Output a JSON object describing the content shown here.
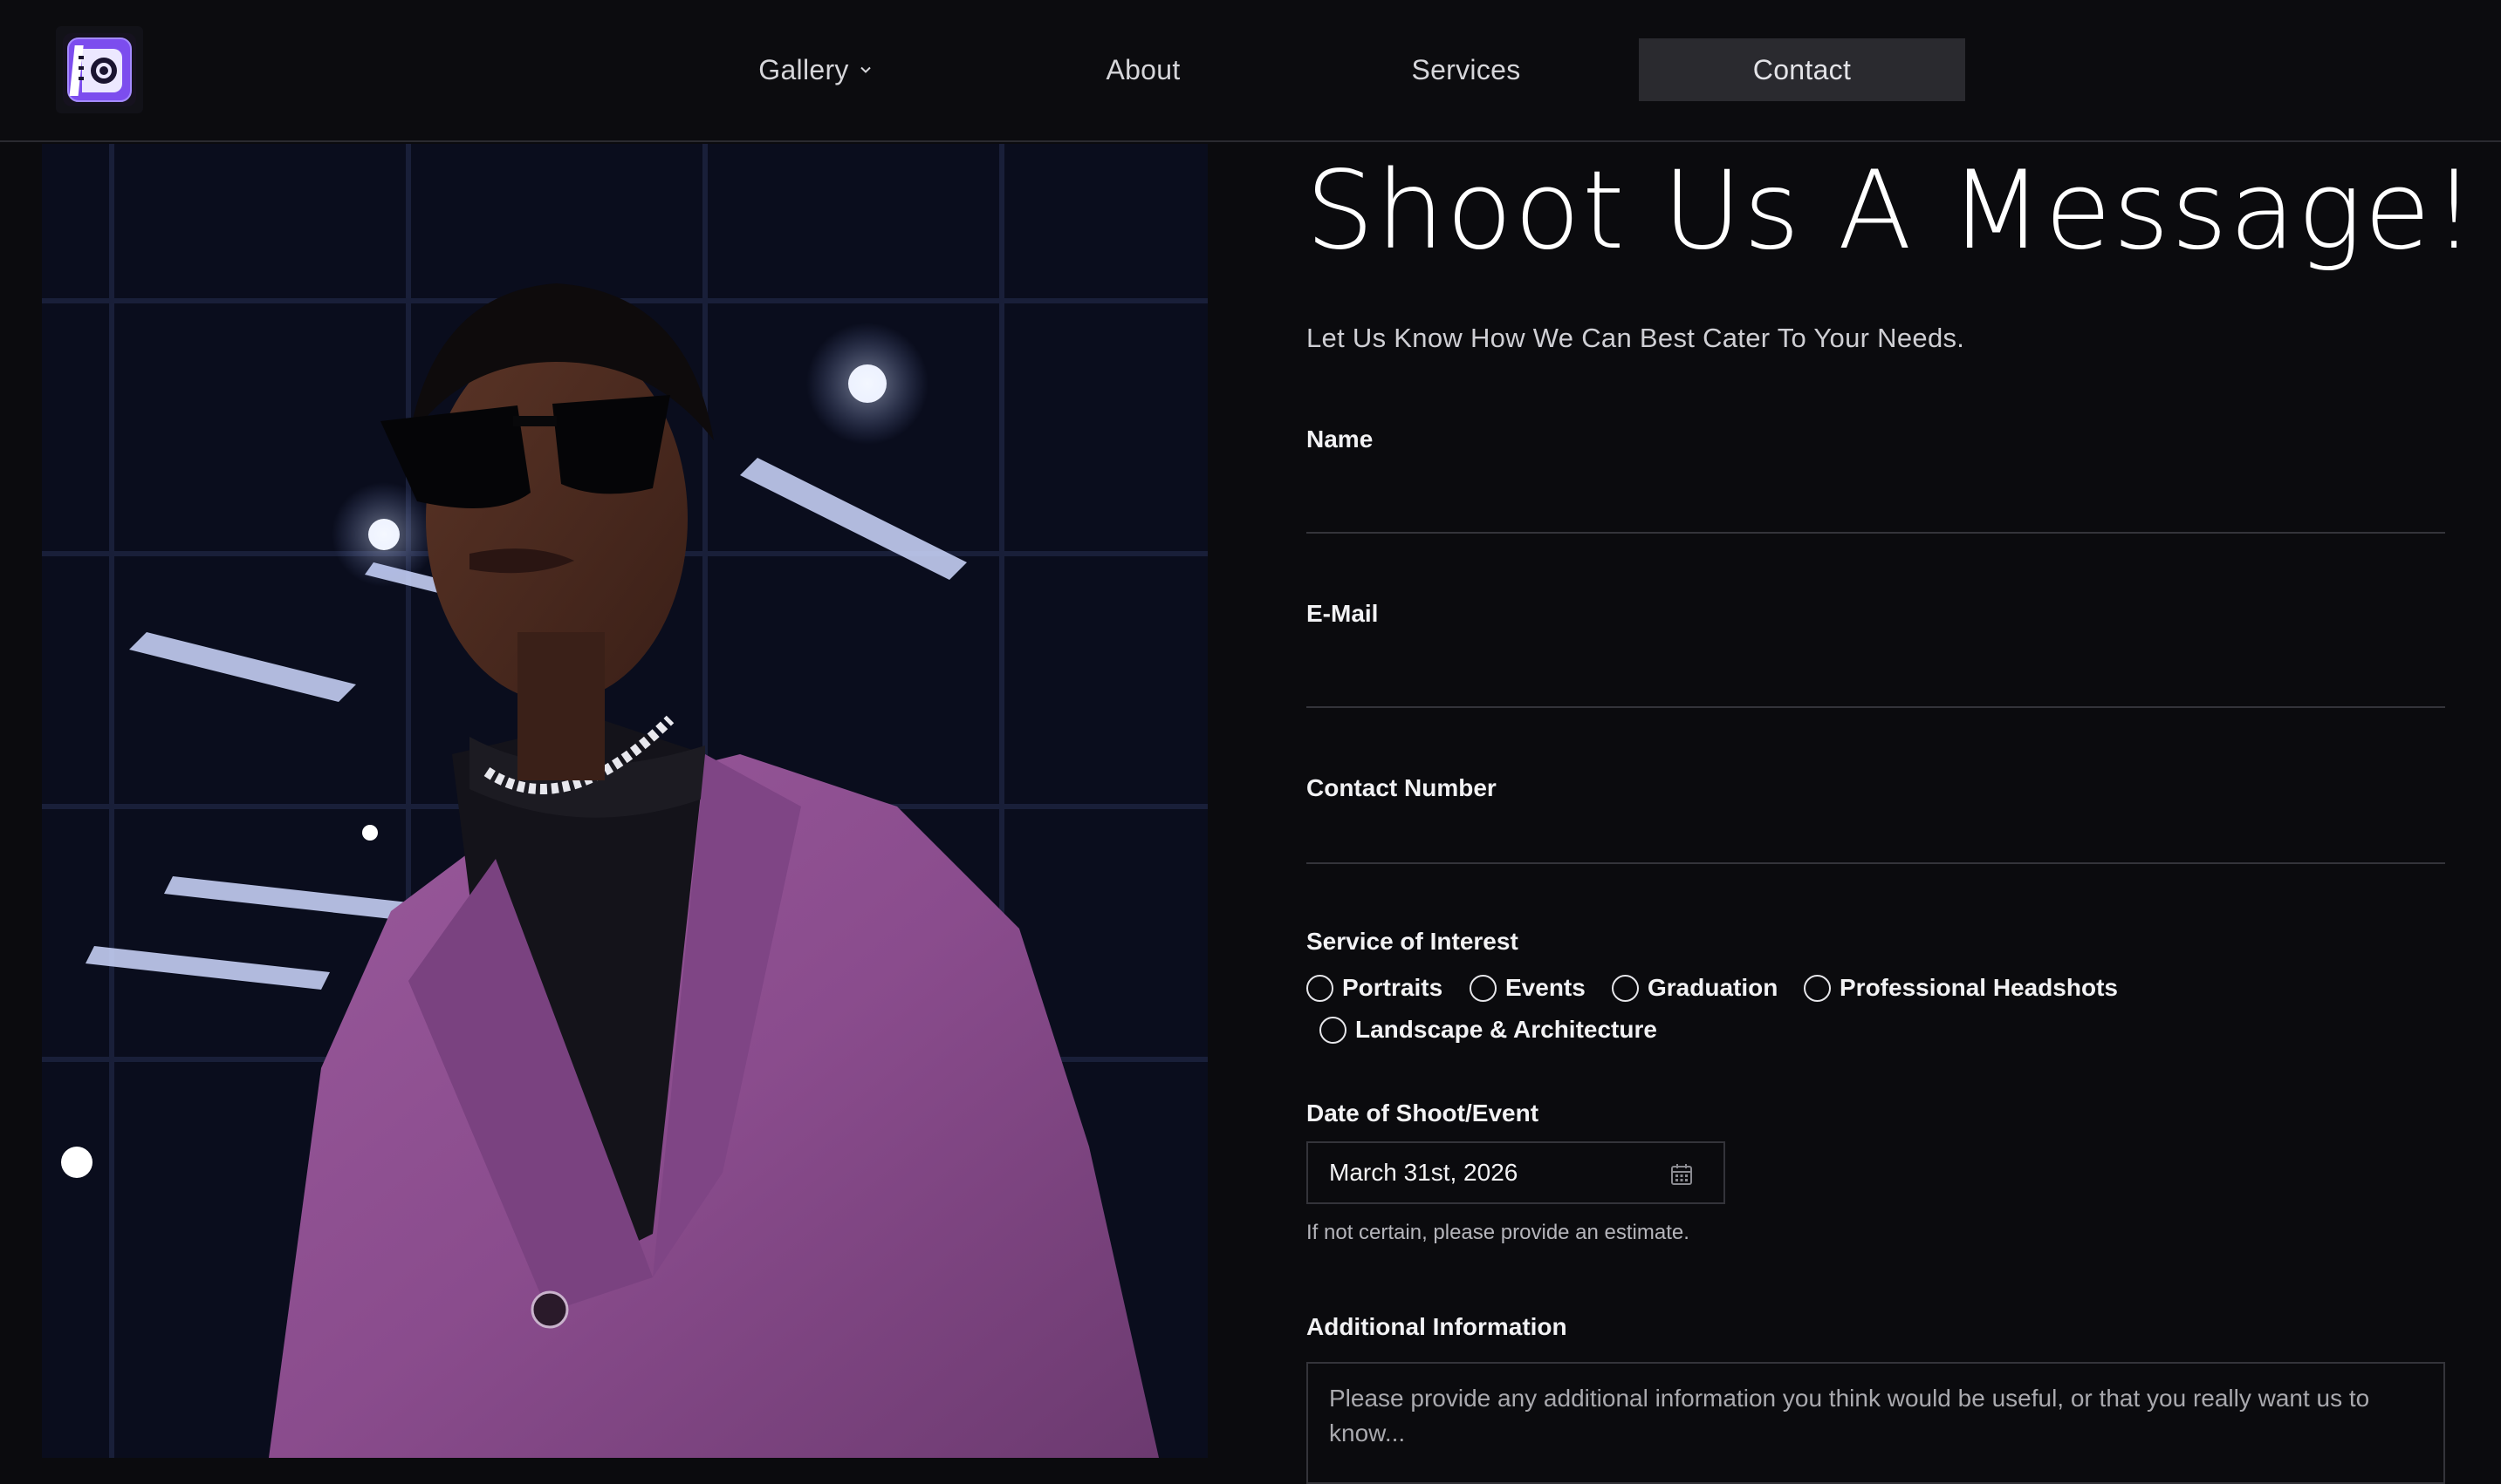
{
  "nav": {
    "items": [
      {
        "label": "Gallery",
        "has_dropdown": true
      },
      {
        "label": "About"
      },
      {
        "label": "Services"
      },
      {
        "label": "Contact",
        "active": true
      }
    ]
  },
  "logo": {
    "icon": "camera-logo-icon",
    "accent": "#8b5cf6"
  },
  "form": {
    "title": "Shoot Us A Message!",
    "subtitle": "Let Us Know How We Can Best Cater To Your Needs.",
    "name_label": "Name",
    "name_value": "",
    "email_label": "E-Mail",
    "email_value": "",
    "contact_label": "Contact Number",
    "contact_value": "",
    "service_label": "Service of Interest",
    "services": [
      "Portraits",
      "Events",
      "Graduation",
      "Professional Headshots",
      "Landscape & Architecture"
    ],
    "date_label": "Date of Shoot/Event",
    "date_value": "March 31st, 2026",
    "date_hint": "If not certain, please provide an estimate.",
    "info_label": "Additional Information",
    "info_placeholder": "Please provide any additional information you think would be useful, or that you really want us to know..."
  },
  "colors": {
    "background": "#0b0b0e",
    "nav_active_bg": "#2a2a2f",
    "suit_purple": "#8a4f8c",
    "divider": "#34343a"
  }
}
